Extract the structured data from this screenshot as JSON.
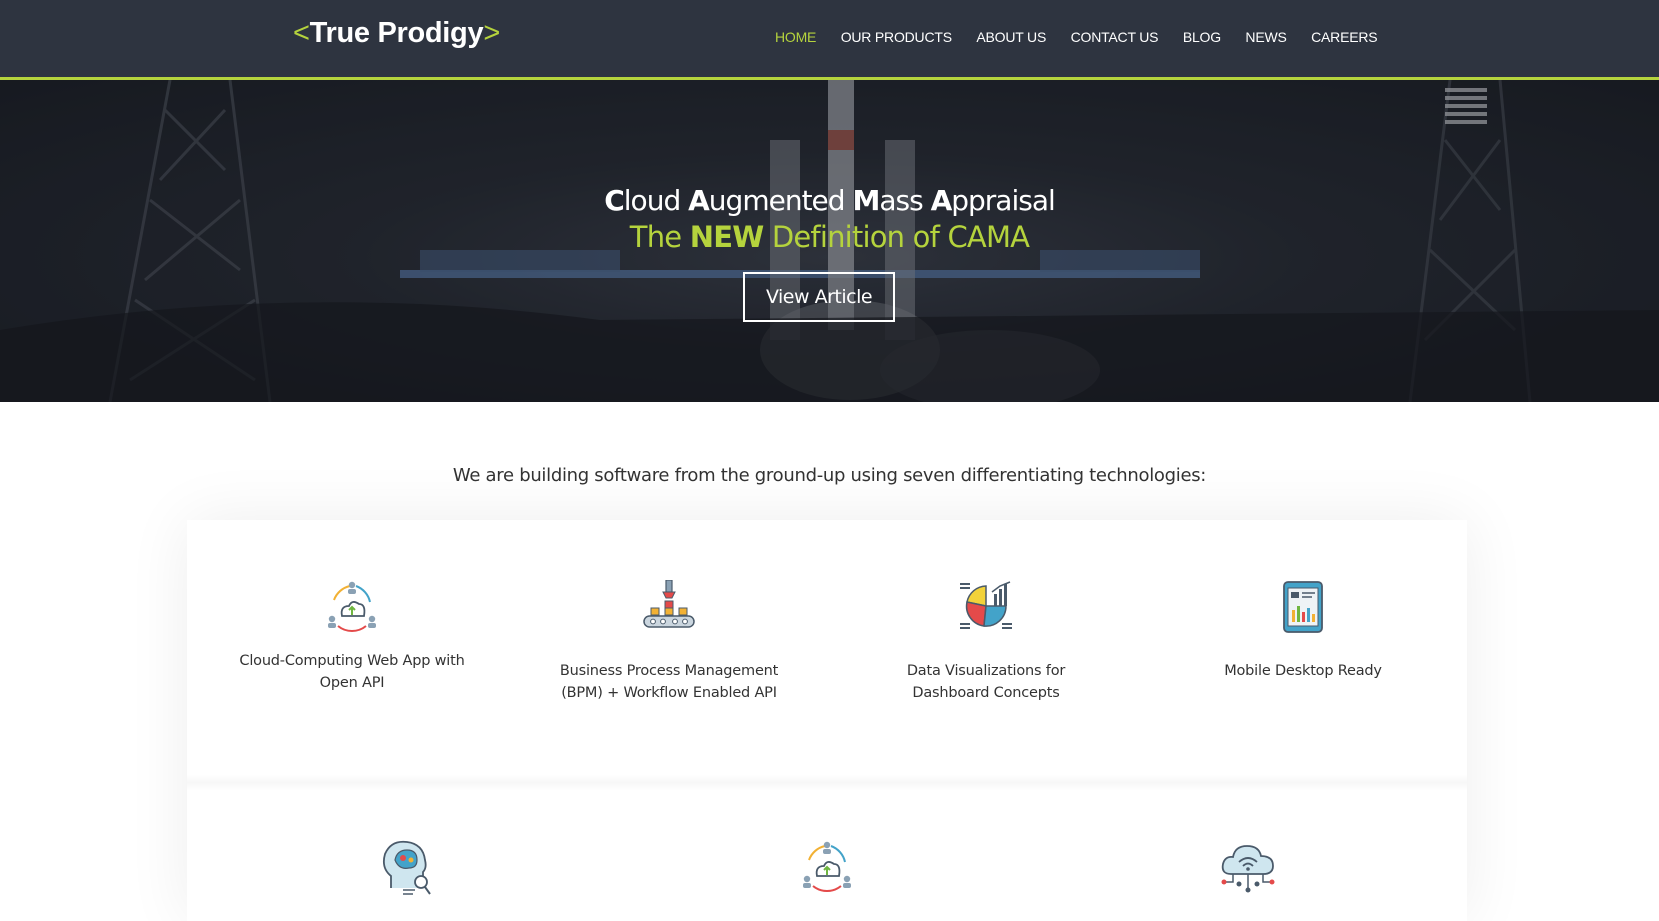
{
  "brand": {
    "open": "<",
    "name": "True Prodigy",
    "close": ">"
  },
  "nav": {
    "items": [
      {
        "label": "HOME",
        "active": true
      },
      {
        "label": "OUR PRODUCTS"
      },
      {
        "label": "ABOUT US"
      },
      {
        "label": "CONTACT US"
      },
      {
        "label": "BLOG"
      },
      {
        "label": "NEWS"
      },
      {
        "label": "CAREERS"
      }
    ]
  },
  "hero": {
    "title_words": [
      {
        "first": "C",
        "rest": "loud"
      },
      {
        "first": "A",
        "rest": "ugmented"
      },
      {
        "first": "M",
        "rest": "ass"
      },
      {
        "first": "A",
        "rest": "ppraisal"
      }
    ],
    "sub_pre": "The ",
    "sub_bold": "NEW",
    "sub_post": " Definition of CAMA",
    "button": "View Article"
  },
  "intro": "We are building software from the ground-up using seven differentiating technologies:",
  "features": [
    {
      "icon": "cloud-network-icon",
      "line1": "Cloud-Computing Web App with",
      "line2": "Open API"
    },
    {
      "icon": "workflow-conveyor-icon",
      "line1": "Business Process Management",
      "line2": "(BPM) + Workflow Enabled API"
    },
    {
      "icon": "pie-chart-icon",
      "line1": "Data Visualizations for",
      "line2": "Dashboard Concepts"
    },
    {
      "icon": "tablet-dashboard-icon",
      "line1": "Mobile Desktop Ready",
      "line2": ""
    },
    {
      "icon": "ai-head-icon"
    },
    {
      "icon": "cloud-network-icon"
    },
    {
      "icon": "cloud-wifi-icon"
    }
  ],
  "colors": {
    "nav_bg": "#2e3440",
    "accent": "#b5d33d",
    "text": "#333333"
  }
}
